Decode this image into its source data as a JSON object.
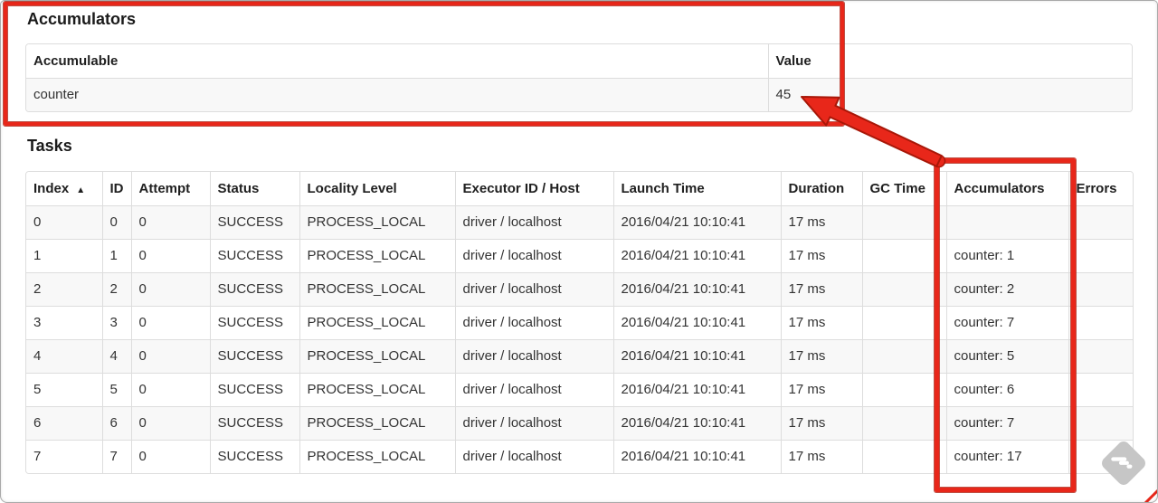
{
  "accumulators_section": {
    "title": "Accumulators",
    "table": {
      "headers": {
        "accumulable": "Accumulable",
        "value": "Value"
      },
      "rows": [
        {
          "accumulable": "counter",
          "value": "45"
        }
      ]
    }
  },
  "tasks_section": {
    "title": "Tasks",
    "table": {
      "headers": {
        "index": "Index",
        "id": "ID",
        "attempt": "Attempt",
        "status": "Status",
        "locality": "Locality Level",
        "executor": "Executor ID / Host",
        "launch": "Launch Time",
        "duration": "Duration",
        "gc": "GC Time",
        "accumulators": "Accumulators",
        "errors": "Errors"
      },
      "sort": {
        "column": "index",
        "direction_icon": "▲"
      },
      "rows": [
        {
          "index": "0",
          "id": "0",
          "attempt": "0",
          "status": "SUCCESS",
          "locality": "PROCESS_LOCAL",
          "executor": "driver / localhost",
          "launch": "2016/04/21 10:10:41",
          "duration": "17 ms",
          "gc": "",
          "accumulators": "",
          "errors": ""
        },
        {
          "index": "1",
          "id": "1",
          "attempt": "0",
          "status": "SUCCESS",
          "locality": "PROCESS_LOCAL",
          "executor": "driver / localhost",
          "launch": "2016/04/21 10:10:41",
          "duration": "17 ms",
          "gc": "",
          "accumulators": "counter: 1",
          "errors": ""
        },
        {
          "index": "2",
          "id": "2",
          "attempt": "0",
          "status": "SUCCESS",
          "locality": "PROCESS_LOCAL",
          "executor": "driver / localhost",
          "launch": "2016/04/21 10:10:41",
          "duration": "17 ms",
          "gc": "",
          "accumulators": "counter: 2",
          "errors": ""
        },
        {
          "index": "3",
          "id": "3",
          "attempt": "0",
          "status": "SUCCESS",
          "locality": "PROCESS_LOCAL",
          "executor": "driver / localhost",
          "launch": "2016/04/21 10:10:41",
          "duration": "17 ms",
          "gc": "",
          "accumulators": "counter: 7",
          "errors": ""
        },
        {
          "index": "4",
          "id": "4",
          "attempt": "0",
          "status": "SUCCESS",
          "locality": "PROCESS_LOCAL",
          "executor": "driver / localhost",
          "launch": "2016/04/21 10:10:41",
          "duration": "17 ms",
          "gc": "",
          "accumulators": "counter: 5",
          "errors": ""
        },
        {
          "index": "5",
          "id": "5",
          "attempt": "0",
          "status": "SUCCESS",
          "locality": "PROCESS_LOCAL",
          "executor": "driver / localhost",
          "launch": "2016/04/21 10:10:41",
          "duration": "17 ms",
          "gc": "",
          "accumulators": "counter: 6",
          "errors": ""
        },
        {
          "index": "6",
          "id": "6",
          "attempt": "0",
          "status": "SUCCESS",
          "locality": "PROCESS_LOCAL",
          "executor": "driver / localhost",
          "launch": "2016/04/21 10:10:41",
          "duration": "17 ms",
          "gc": "",
          "accumulators": "counter: 7",
          "errors": ""
        },
        {
          "index": "7",
          "id": "7",
          "attempt": "0",
          "status": "SUCCESS",
          "locality": "PROCESS_LOCAL",
          "executor": "driver / localhost",
          "launch": "2016/04/21 10:10:41",
          "duration": "17 ms",
          "gc": "",
          "accumulators": "counter: 17",
          "errors": ""
        }
      ]
    }
  },
  "annotations": {
    "highlight_color": "#e8271a",
    "outline_color": "#a81708",
    "box_1": "accumulators-section-highlight",
    "box_2": "tasks-accumulators-column-highlight",
    "arrow": "from-accumulators-column-to-value-45"
  },
  "watermark": {
    "icon": "skitch-watermark-icon",
    "color": "#c6c6c6"
  }
}
